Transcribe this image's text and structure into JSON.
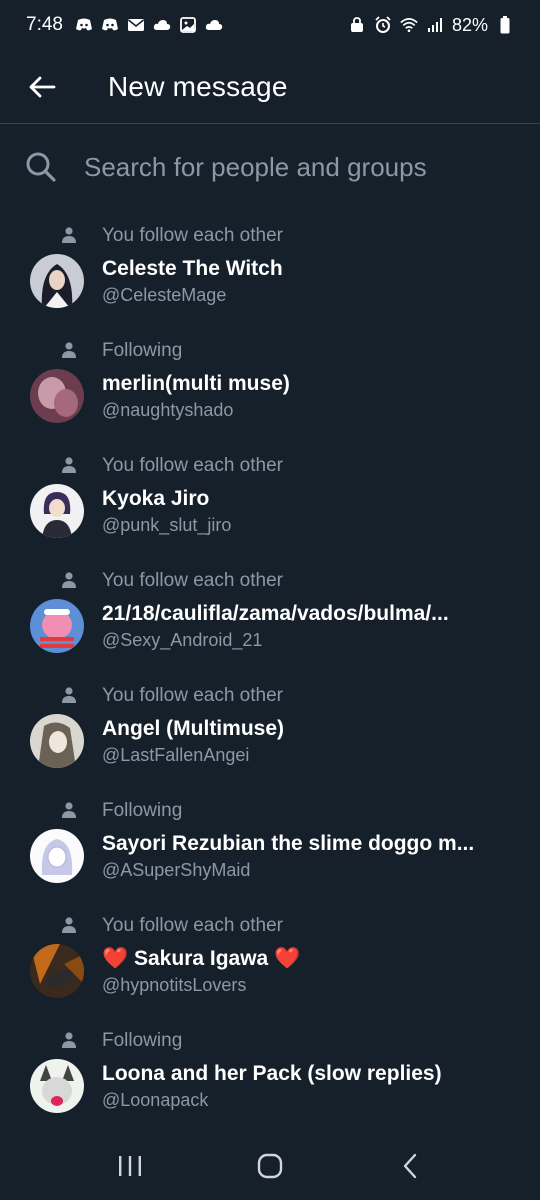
{
  "status_bar": {
    "time": "7:48",
    "battery": "82%"
  },
  "header": {
    "title": "New message",
    "back_icon": "arrow-left-icon"
  },
  "search": {
    "placeholder": "Search for people and groups",
    "value": ""
  },
  "colors": {
    "background": "#15202b",
    "secondary_text": "#8b98a5",
    "divider": "#38444d",
    "heart": "#e0245e"
  },
  "contacts": [
    {
      "relation": "You follow each other",
      "name": "Celeste The Witch",
      "handle": "@CelesteMage"
    },
    {
      "relation": "Following",
      "name": "merlin(multi muse)",
      "handle": "@naughtyshado"
    },
    {
      "relation": "You follow each other",
      "name": "Kyoka Jiro",
      "handle": "@punk_slut_jiro"
    },
    {
      "relation": "You follow each other",
      "name": "21/18/caulifla/zama/vados/bulma/...",
      "handle": "@Sexy_Android_21"
    },
    {
      "relation": "You follow each other",
      "name": "Angel (Multimuse)",
      "handle": "@LastFallenAngei"
    },
    {
      "relation": "Following",
      "name": "Sayori Rezubian the slime doggo m...",
      "handle": "@ASuperShyMaid"
    },
    {
      "relation": "You follow each other",
      "name": "Sakura Igawa",
      "name_prefix": "❤️",
      "name_suffix": "❤️",
      "handle": "@hypnotitsLovers"
    },
    {
      "relation": "Following",
      "name": "Loona and her Pack (slow replies)",
      "handle": "@Loonapack"
    }
  ]
}
